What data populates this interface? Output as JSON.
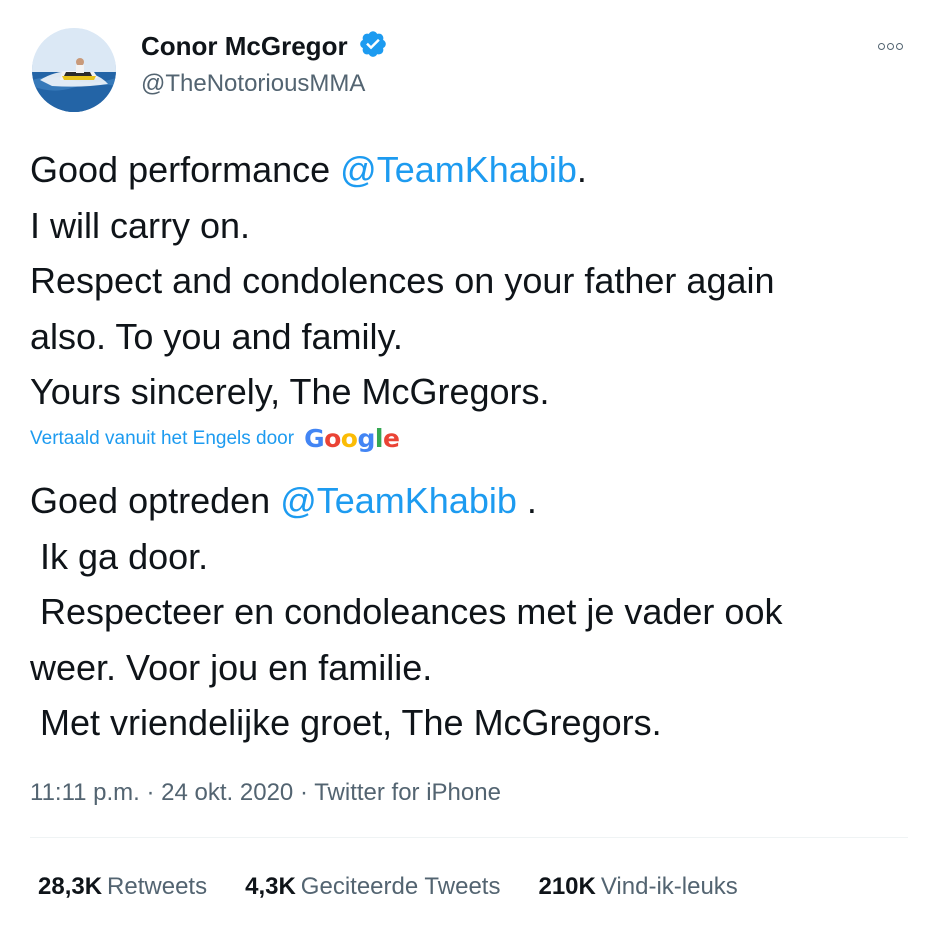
{
  "author": {
    "display_name": "Conor McGregor",
    "handle": "@TheNotoriousMMA",
    "verified": true,
    "avatar_icon": "jetski-photo-avatar"
  },
  "tweet": {
    "line1_prefix": "Good performance ",
    "line1_mention": "@TeamKhabib",
    "line1_suffix": ".",
    "line2": "I will carry on.",
    "line3": "Respect and condolences on your father again",
    "line4": "also. To you and family.",
    "line5": "Yours sincerely, The McGregors."
  },
  "translation": {
    "label": "Vertaald vanuit het Engels door",
    "provider": "Google",
    "line1_prefix": "Goed optreden ",
    "line1_mention": "@TeamKhabib",
    "line1_suffix": " .",
    "line2": " Ik ga door.",
    "line3": " Respecteer en condoleances met je vader ook",
    "line4": "weer. Voor jou en familie.",
    "line5": " Met vriendelijke groet, The McGregors."
  },
  "meta": {
    "time": "11:11 p.m.",
    "separator": " · ",
    "date": "24 okt. 2020",
    "source": "Twitter for iPhone"
  },
  "stats": {
    "retweets_count": "28,3K",
    "retweets_label": "Retweets",
    "quotes_count": "4,3K",
    "quotes_label": "Geciteerde Tweets",
    "likes_count": "210K",
    "likes_label": "Vind-ik-leuks"
  },
  "colors": {
    "link": "#1d9bf0",
    "text": "#0f1419",
    "secondary": "#536471",
    "verified": "#1d9bf0"
  }
}
